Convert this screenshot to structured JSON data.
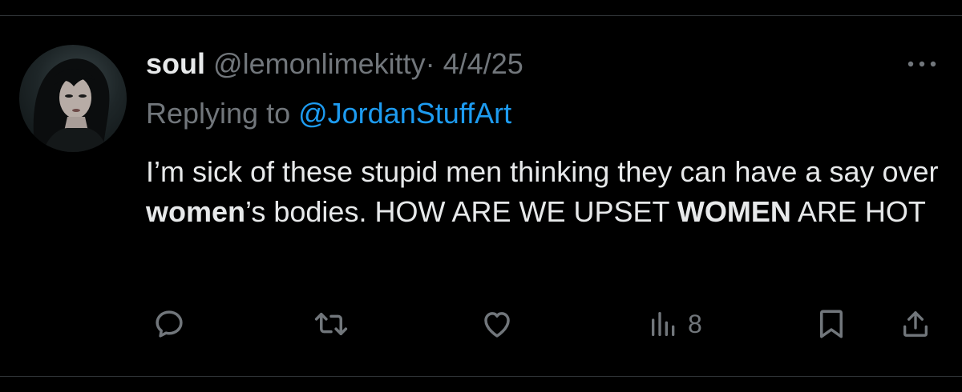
{
  "tweet": {
    "display_name": "soul",
    "handle": "@lemonlimekitty",
    "separator": "·",
    "date": "4/4/25",
    "replying_prefix": "Replying to ",
    "replying_to": "@JordanStuffArt",
    "text_segments": [
      {
        "text": "I’m sick of these stupid men thinking they can have a say over ",
        "bold": false
      },
      {
        "text": "women",
        "bold": true
      },
      {
        "text": "’s bodies. HOW ARE WE UPSET ",
        "bold": false
      },
      {
        "text": "WOMEN",
        "bold": true
      },
      {
        "text": " ARE HOT",
        "bold": false
      }
    ]
  },
  "actions": {
    "reply_icon": "speech-bubble-icon",
    "retweet_icon": "retweet-icon",
    "like_icon": "heart-icon",
    "views_icon": "bar-chart-icon",
    "views_count": "8",
    "bookmark_icon": "bookmark-icon",
    "share_icon": "share-upload-icon",
    "more_icon": "more-dots-icon"
  },
  "colors": {
    "background": "#000000",
    "text_primary": "#e7e9ea",
    "text_secondary": "#71767b",
    "link": "#1d9bf0",
    "divider": "#2f3336"
  }
}
